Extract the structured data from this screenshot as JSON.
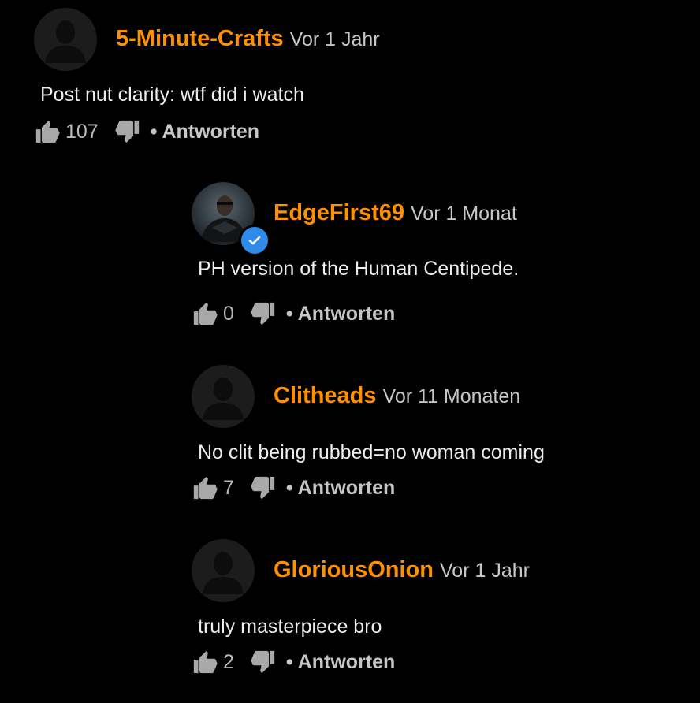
{
  "comments": [
    {
      "username": "5-Minute-Crafts",
      "timestamp": "Vor 1 Jahr",
      "text": "Post nut clarity: wtf did i watch",
      "likes": "107",
      "reply_label": "Antworten",
      "verified": false
    },
    {
      "username": "EdgeFirst69",
      "timestamp": "Vor 1 Monat",
      "text": "PH version of the Human Centipede.",
      "likes": "0",
      "reply_label": "Antworten",
      "verified": true
    },
    {
      "username": "Clitheads",
      "timestamp": "Vor 11 Monaten",
      "text": "No clit being rubbed=no woman coming",
      "likes": "7",
      "reply_label": "Antworten",
      "verified": false
    },
    {
      "username": "GloriousOnion",
      "timestamp": "Vor 1 Jahr",
      "text": "truly masterpiece bro",
      "likes": "2",
      "reply_label": "Antworten",
      "verified": false
    }
  ],
  "icons": {
    "like": "thumbs-up-icon",
    "dislike": "thumbs-down-icon",
    "verified": "checkmark-icon",
    "avatar_placeholder": "user-silhouette-icon"
  },
  "colors": {
    "background": "#000000",
    "username": "#ff9000",
    "verified": "#2f8bea",
    "muted_text": "#c6c6c6"
  }
}
